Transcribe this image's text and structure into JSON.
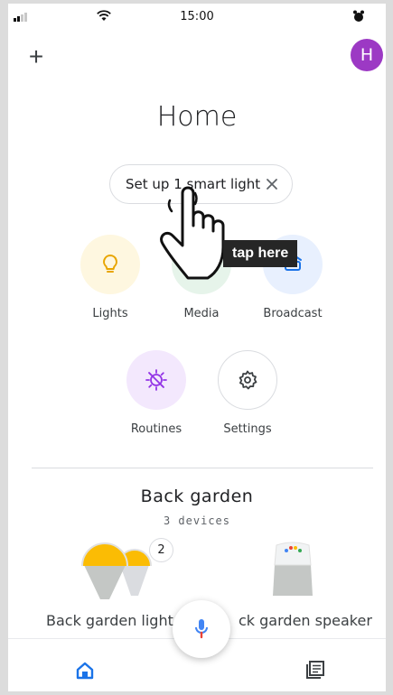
{
  "status_bar": {
    "time": "15:00"
  },
  "header": {
    "add_label": "+",
    "avatar_letter": "H",
    "title": "Home"
  },
  "chip": {
    "label": "Set up 1 smart light"
  },
  "actions": {
    "lights": {
      "label": "Lights",
      "icon": "bulb-icon",
      "color": "#fef7e0"
    },
    "media": {
      "label": "Media",
      "icon": "media-icon",
      "color": "#e6f4ea"
    },
    "broadcast": {
      "label": "Broadcast",
      "icon": "broadcast-icon",
      "color": "#e8f0fe"
    },
    "routines": {
      "label": "Routines",
      "icon": "routines-icon",
      "color": "#f3e8fd"
    },
    "settings": {
      "label": "Settings",
      "icon": "gear-icon",
      "color": "#ffffff"
    }
  },
  "room": {
    "title": "Back garden",
    "device_count": "3 devices",
    "devices": [
      {
        "label": "Back garden light",
        "badge": "2"
      },
      {
        "label": "ck garden speaker"
      }
    ]
  },
  "overlay": {
    "tap_label": "tap here"
  },
  "colors": {
    "accent": "#1a73e8",
    "avatar": "#9c39c4",
    "mic_red": "#ea4335"
  }
}
